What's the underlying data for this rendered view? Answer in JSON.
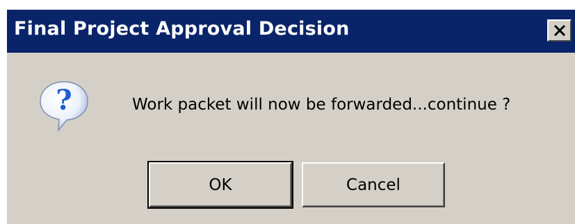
{
  "dialog": {
    "title": "Final Project Approval Decision",
    "message": "Work packet will now be forwarded...continue ?",
    "icon": "question-icon",
    "close_icon": "close-icon",
    "buttons": {
      "ok_label": "OK",
      "cancel_label": "Cancel"
    }
  },
  "colors": {
    "titlebar": "#0a246a",
    "dialog_bg": "#d4d0c8",
    "icon_blue": "#1f5fd0"
  }
}
